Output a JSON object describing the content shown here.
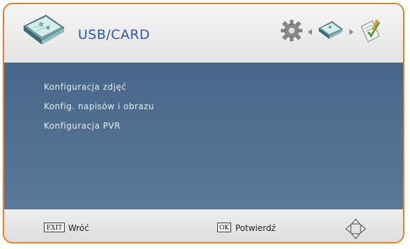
{
  "header": {
    "title": "USB/CARD",
    "icon": "photo-album-icon",
    "breadcrumb": [
      "gear-icon",
      "photo-album-icon",
      "checklist-icon"
    ]
  },
  "menu": {
    "items": [
      {
        "label": "Konfiguracja zdjęć"
      },
      {
        "label": "Konfig. napisów i obrazu"
      },
      {
        "label": "Konfiguracja PVR"
      }
    ]
  },
  "footer": {
    "exit_key": "EXIT",
    "exit_label": "Wróć",
    "ok_key": "OK",
    "ok_label": "Potwierdź",
    "nav_icon": "dpad-icon"
  },
  "colors": {
    "frame": "#e8801f",
    "title": "#2c55b8",
    "menu_bg": "#4f6e90",
    "menu_text": "#e6ecf4"
  }
}
